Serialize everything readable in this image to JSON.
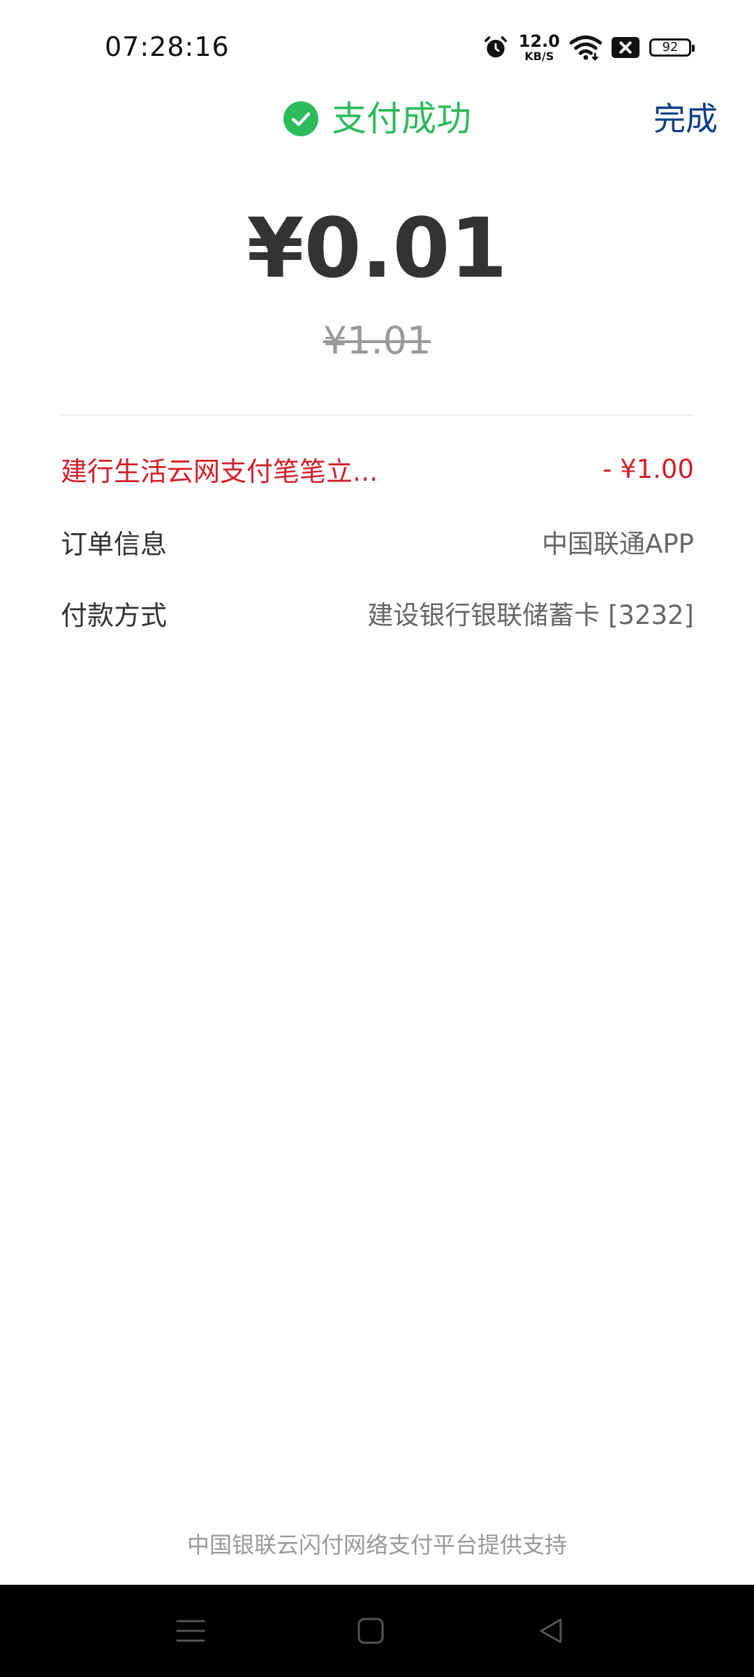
{
  "status_bar": {
    "time": "07:28:16",
    "net_speed_value": "12.0",
    "net_speed_unit": "KB/S",
    "battery_level": "92",
    "icons": [
      "alarm-icon",
      "wifi-icon",
      "sim-disabled-icon",
      "battery-icon"
    ]
  },
  "header": {
    "title": "支付成功",
    "done_label": "完成",
    "title_color": "#2dbb5b",
    "done_color": "#0a3f88"
  },
  "payment": {
    "amount": "¥0.01",
    "original_amount": "¥1.01"
  },
  "details": {
    "discount": {
      "text": "建行生活云网支付笔笔立...",
      "amount": "- ¥1.00",
      "color": "#d0212a"
    },
    "order_info": {
      "label": "订单信息",
      "value": "中国联通APP"
    },
    "payment_method": {
      "label": "付款方式",
      "value": "建设银行银联储蓄卡 [3232]"
    }
  },
  "footer": {
    "text": "中国银联云闪付网络支付平台提供支持"
  },
  "nav_bar": {
    "icons": [
      "menu-icon",
      "home-icon",
      "back-icon"
    ]
  }
}
